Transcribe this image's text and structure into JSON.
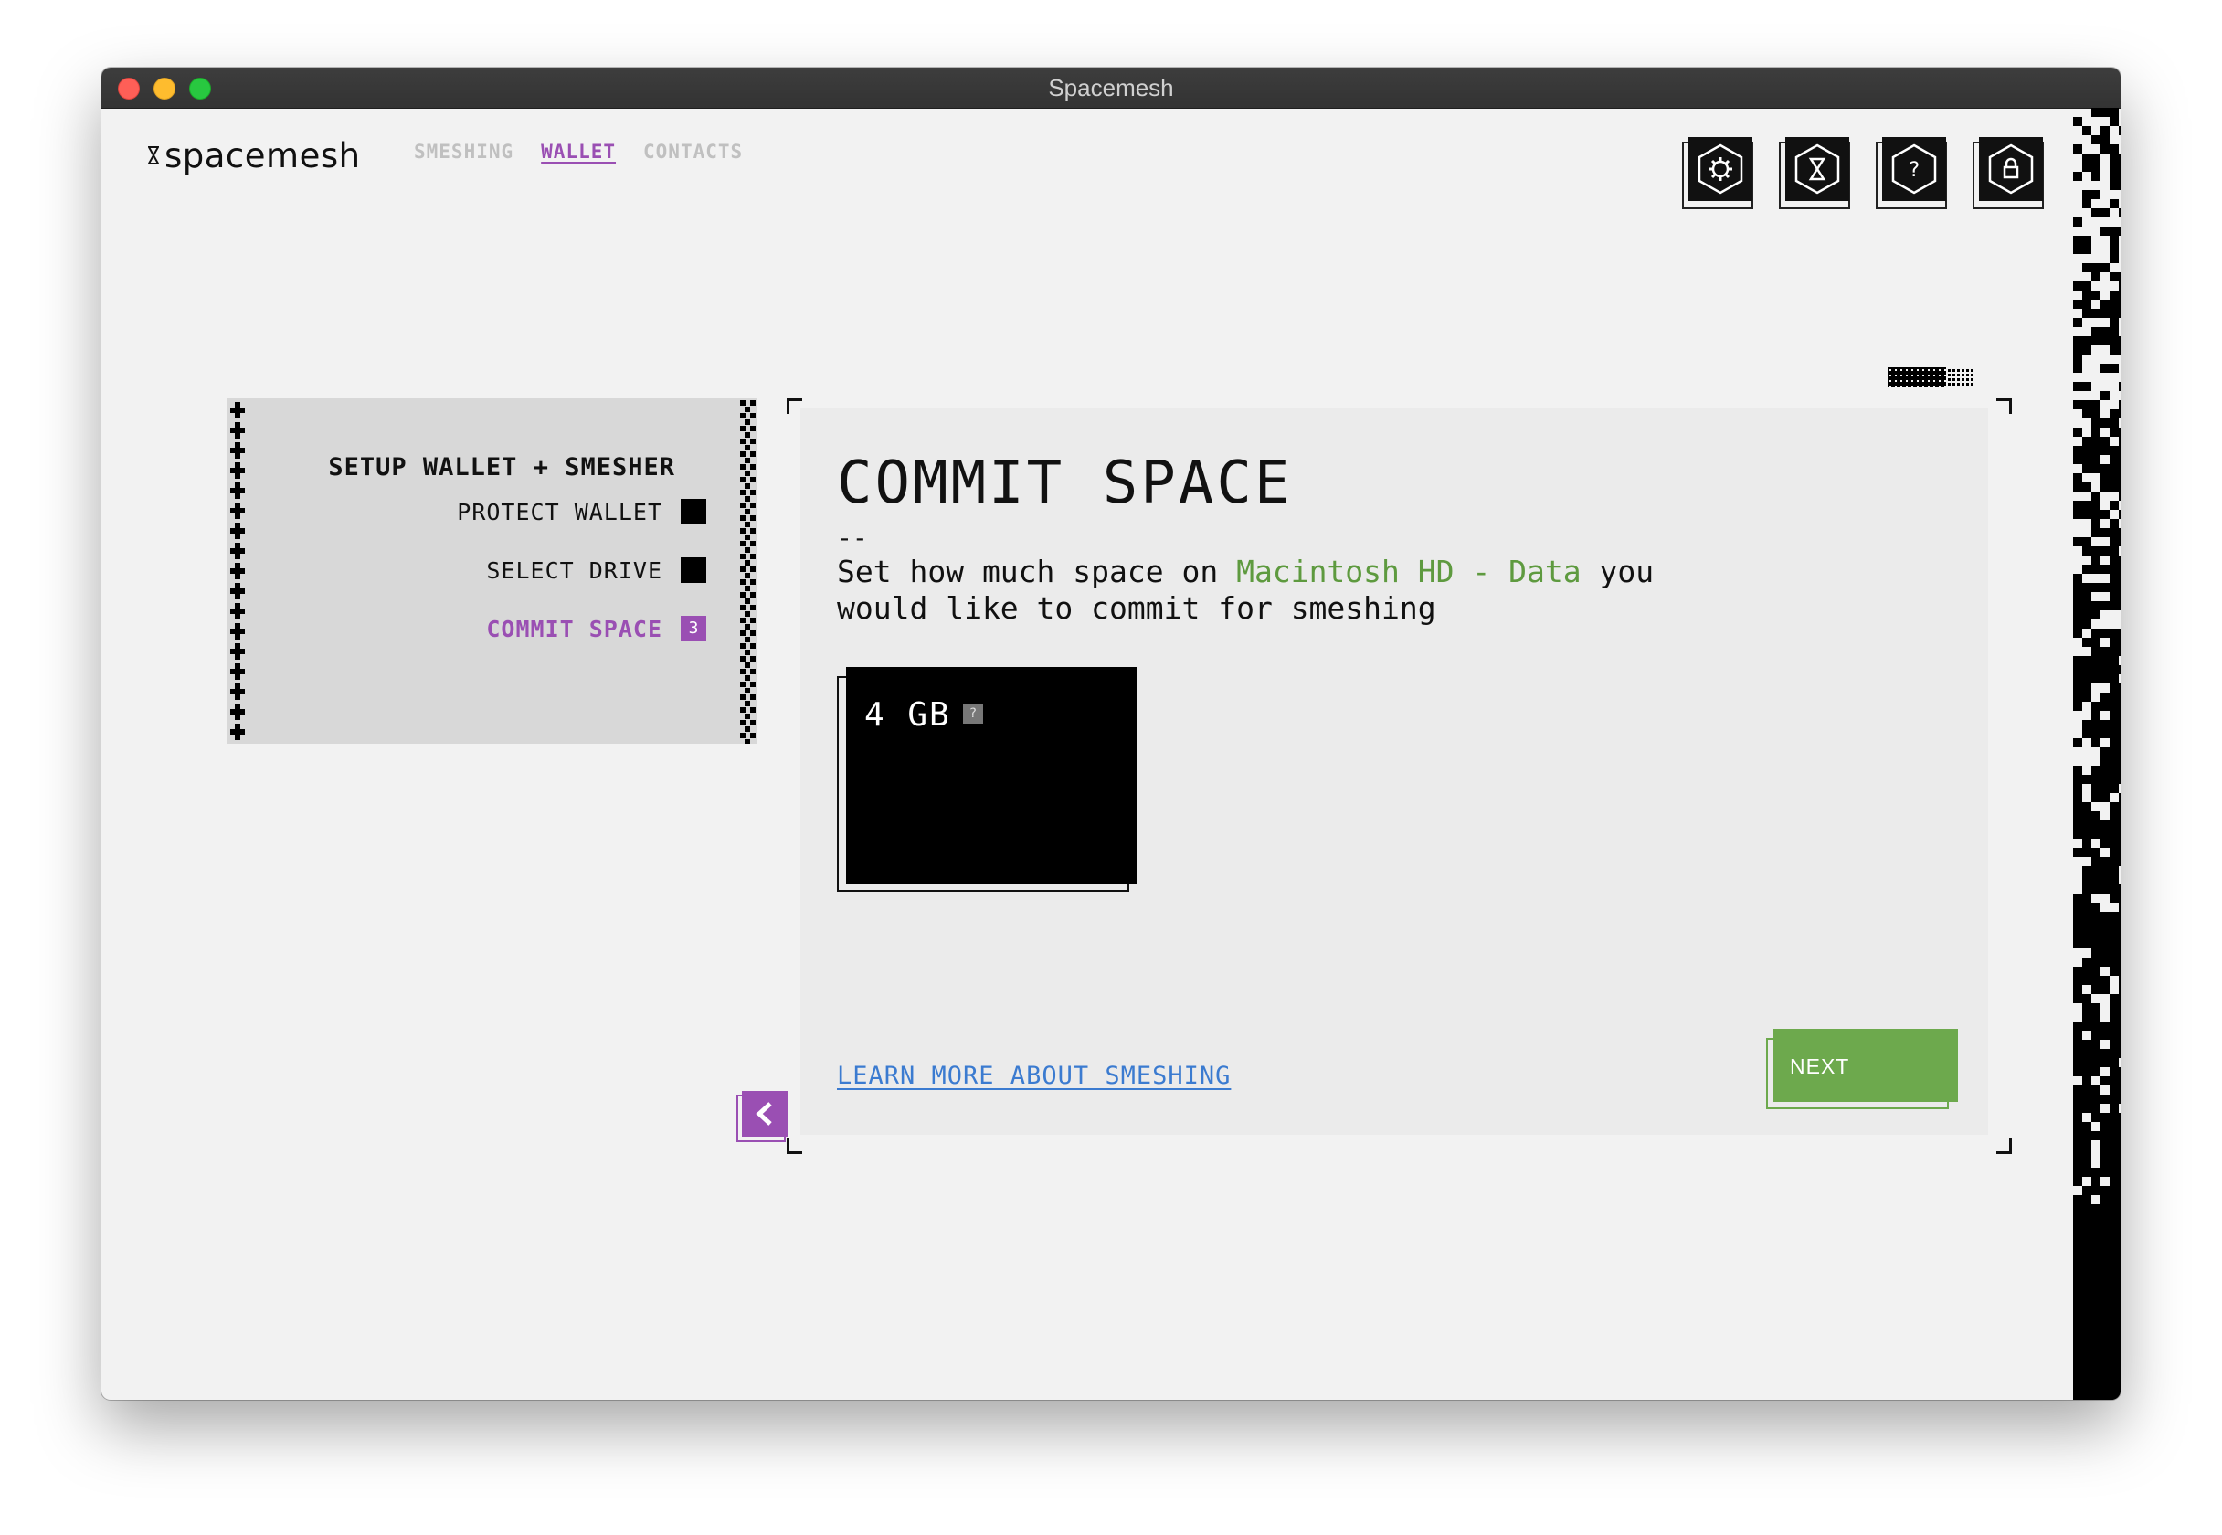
{
  "window": {
    "title": "Spacemesh"
  },
  "header": {
    "logo_text": "spacemesh",
    "nav": [
      {
        "label": "SMESHING",
        "active": false
      },
      {
        "label": "WALLET",
        "active": true
      },
      {
        "label": "CONTACTS",
        "active": false
      }
    ],
    "icon_buttons": [
      "settings-icon",
      "hourglass-icon",
      "help-icon",
      "lock-icon"
    ]
  },
  "steps": {
    "title": "SETUP WALLET + SMESHER",
    "items": [
      {
        "label": "PROTECT WALLET",
        "marker": ""
      },
      {
        "label": "SELECT DRIVE",
        "marker": ""
      },
      {
        "label": "COMMIT SPACE",
        "marker": "3"
      }
    ]
  },
  "main": {
    "title": "COMMIT SPACE",
    "separator": "--",
    "desc_before": "Set how much space on ",
    "desc_highlight": "Macintosh HD - Data",
    "desc_after": " you would like to commit for smeshing",
    "size_option": {
      "label": "4 GB",
      "help": "?"
    },
    "learn_more": "LEARN MORE ABOUT SMESHING",
    "next": "NEXT"
  },
  "colors": {
    "accent_purple": "#9a4fb3",
    "accent_green": "#6da94d",
    "link_blue": "#3b7bd0"
  }
}
